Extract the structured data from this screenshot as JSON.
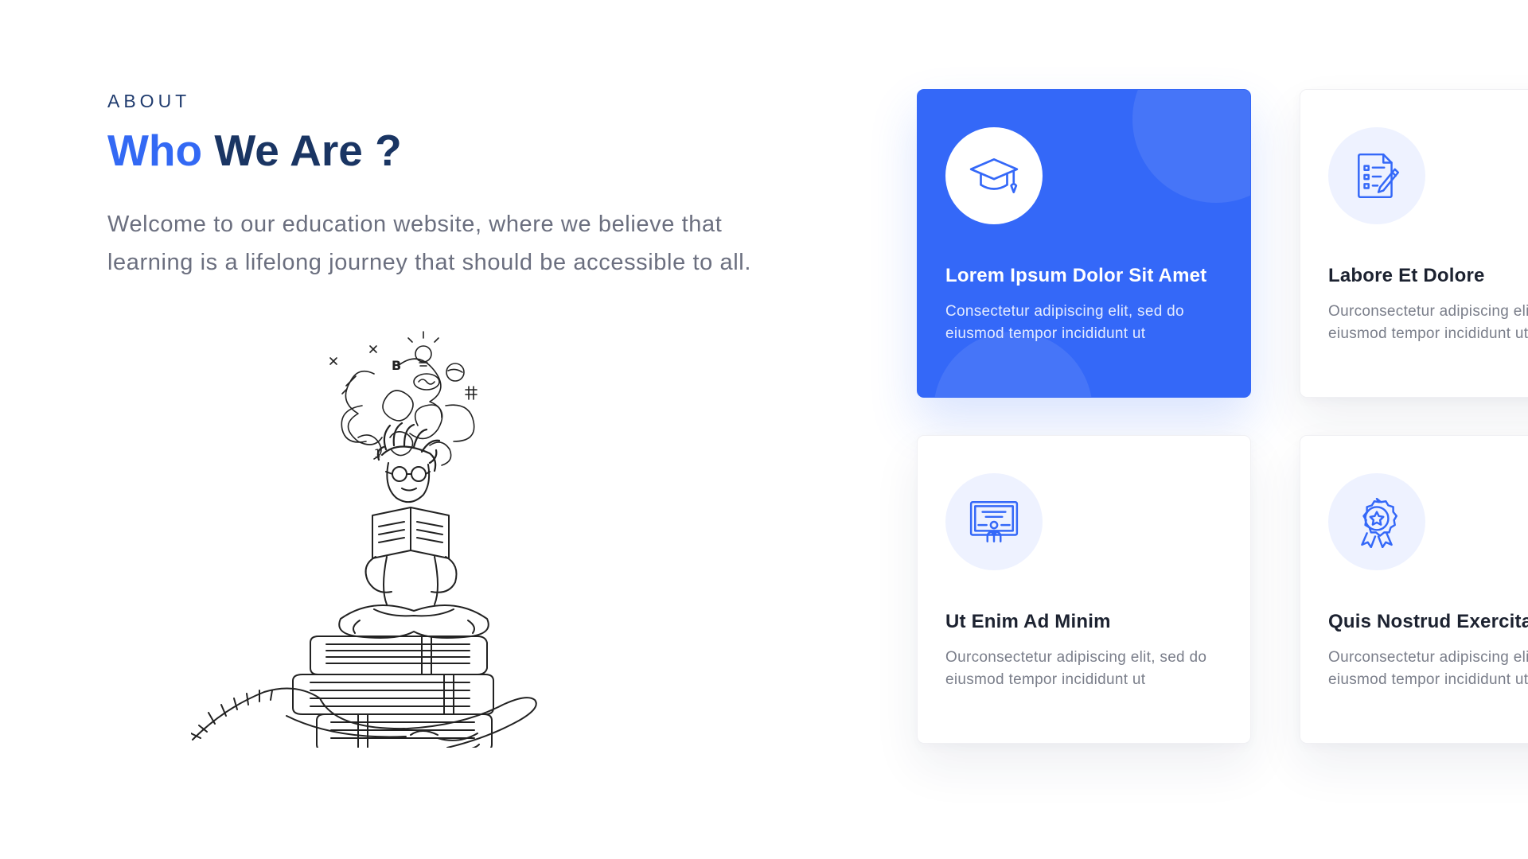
{
  "about": {
    "eyebrow": "ABOUT",
    "title_accent": "Who",
    "title_rest": " We Are ?",
    "intro": "Welcome to our education website, where we believe that learning is a lifelong journey that should be accessible to all."
  },
  "illustration": {
    "icon": "student-reading-on-books-in-hand-icon",
    "doodle_text": [
      "B",
      "1",
      "×",
      "×",
      "#"
    ]
  },
  "colors": {
    "accent": "#3369f4",
    "heading": "#1a3563",
    "featured_card": "#3468f8",
    "body_text": "#6b6f7f",
    "icon_bg": "#eef2ff"
  },
  "cards": [
    {
      "icon": "graduation-cap-icon",
      "title": "Lorem Ipsum Dolor Sit Amet",
      "text": "Consectetur adipiscing elit, sed do eiusmod tempor incididunt ut",
      "featured": true
    },
    {
      "icon": "document-checklist-icon",
      "title": "Labore Et Dolore",
      "text": "Ourconsectetur adipiscing elit, sed do eiusmod tempor incididunt ut",
      "featured": false
    },
    {
      "icon": "certificate-icon",
      "title": "Ut Enim Ad Minim",
      "text": "Ourconsectetur adipiscing elit, sed do eiusmod tempor incididunt ut",
      "featured": false
    },
    {
      "icon": "award-badge-icon",
      "title": "Quis Nostrud Exercitation",
      "text": "Ourconsectetur adipiscing elit, sed do eiusmod tempor incididunt ut",
      "featured": false
    }
  ]
}
